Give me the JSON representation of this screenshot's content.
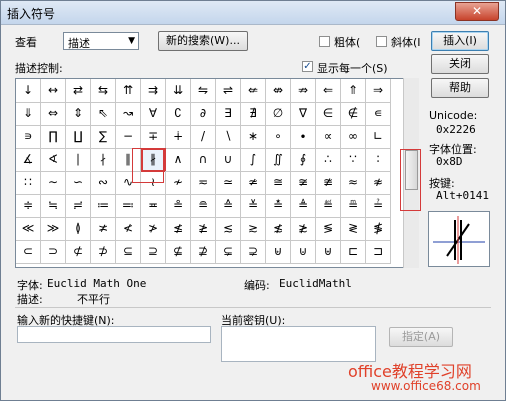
{
  "window": {
    "title": "插入符号",
    "close_icon": "close-icon"
  },
  "lookup": {
    "label": "查看",
    "value": "描述",
    "new_search_button": "新的搜索(W)..."
  },
  "style": {
    "bold_label": "粗体(",
    "italic_label": "斜体(I",
    "bold_checked": false,
    "italic_checked": false
  },
  "buttons": {
    "insert": "插入(I)",
    "close": "关闭",
    "help": "帮助",
    "assign": "指定(A)"
  },
  "grid": {
    "label": "描述控制:",
    "show_each_label": "显示每一个(S)",
    "show_each_checked": true,
    "rows": [
      [
        "↓",
        "↔",
        "⇄",
        "⇆",
        "⇈",
        "⇉",
        "⇊",
        "⇋",
        "⇌",
        "⇍",
        "⇎",
        "⇏",
        "⇐",
        "⇑",
        "⇒"
      ],
      [
        "⇓",
        "⇔",
        "⇕",
        "⇖",
        "↝",
        "∀",
        "∁",
        "∂",
        "∃",
        "∄",
        "∅",
        "∇",
        "∈",
        "∉",
        "∊"
      ],
      [
        "∍",
        "∏",
        "∐",
        "∑",
        "−",
        "∓",
        "∔",
        "/",
        "∖",
        "∗",
        "∘",
        "∙",
        "∝",
        "∞",
        "∟"
      ],
      [
        "∡",
        "∢",
        "∣",
        "∤",
        "∥",
        "∦",
        "∧",
        "∩",
        "∪",
        "∫",
        "∬",
        "∮",
        "∴",
        "∵",
        "∶"
      ],
      [
        "∷",
        "∼",
        "∽",
        "∾",
        "∿",
        "≀",
        "≁",
        "≂",
        "≃",
        "≄",
        "≅",
        "≆",
        "≇",
        "≈",
        "≉"
      ],
      [
        "≑",
        "≒",
        "≓",
        "≔",
        "≕",
        "≖",
        "≗",
        "≘",
        "≙",
        "≚",
        "≛",
        "≜",
        "≝",
        "≞",
        "≟"
      ],
      [
        "≪",
        "≫",
        "≬",
        "≭",
        "≮",
        "≯",
        "≰",
        "≱",
        "≲",
        "≳",
        "≴",
        "≵",
        "≶",
        "≷",
        "≸"
      ],
      [
        "⊂",
        "⊃",
        "⊄",
        "⊅",
        "⊆",
        "⊇",
        "⊈",
        "⊉",
        "⊊",
        "⊋",
        "⊌",
        "⊍",
        "⊎",
        "⊏",
        "⊐"
      ]
    ],
    "selected_row": 3,
    "selected_col": 5
  },
  "info": {
    "unicode_label": "Unicode:",
    "unicode_value": "0x2226",
    "position_label": "字体位置:",
    "position_value": "0x8D",
    "key_label": "按键:",
    "key_value": "Alt+0141"
  },
  "details": {
    "font_label": "字体:",
    "font_value": "Euclid Math One",
    "encoding_label": "编码:",
    "encoding_value": "EuclidMathl",
    "desc_label": "描述:",
    "desc_value": "不平行"
  },
  "shortcut": {
    "new_label": "输入新的快捷键(N):",
    "current_label": "当前密钥(U):",
    "new_value": "",
    "current_value": ""
  },
  "watermark": {
    "line1": "office教程学习网",
    "line2": "www.office68.com"
  },
  "colors": {
    "highlight": "#d43a3a",
    "watermark": "#e0412a"
  }
}
